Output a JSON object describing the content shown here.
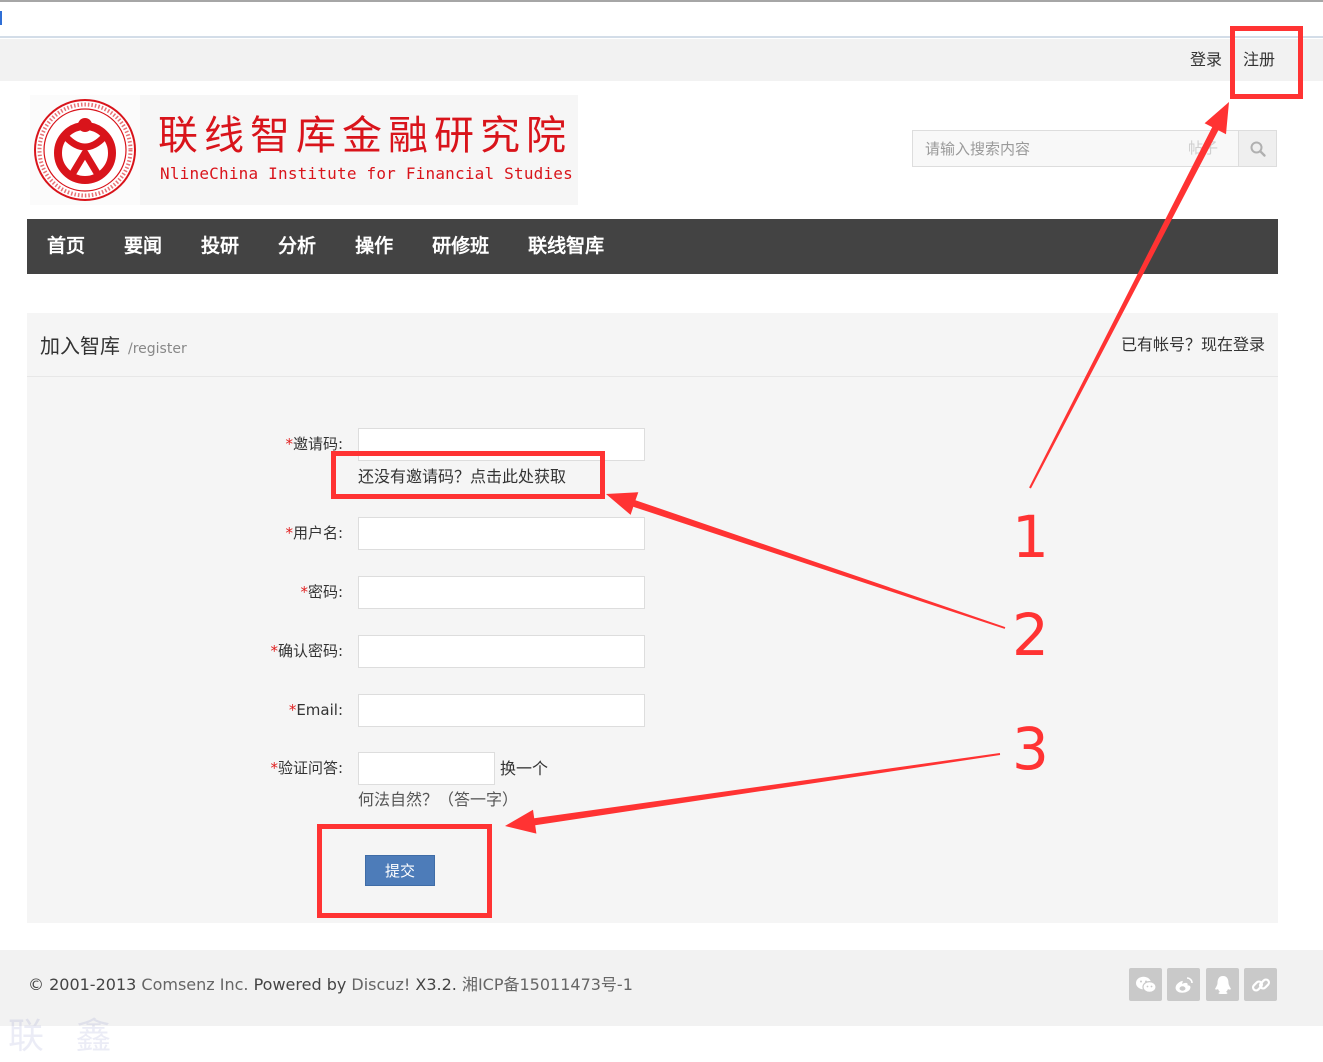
{
  "topbar": {
    "login": "登录",
    "register": "注册"
  },
  "logo": {
    "title_cn": "联线智库金融研究院",
    "title_en": "NlineChina Institute for Financial Studies",
    "brand_color": "#d9141b"
  },
  "search": {
    "placeholder": "请输入搜索内容",
    "scope": "帖子",
    "icon": "search-icon"
  },
  "nav": {
    "items": [
      "首页",
      "要闻",
      "投研",
      "分析",
      "操作",
      "研修班",
      "联线智库"
    ],
    "background": "#434343"
  },
  "panel": {
    "title": "加入智库",
    "subtitle": "/register",
    "login_prompt": "已有帐号？现在登录"
  },
  "form": {
    "required_mark": "*",
    "fields": [
      {
        "label": "邀请码:",
        "value": ""
      },
      {
        "label": "用户名:",
        "value": ""
      },
      {
        "label": "密码:",
        "value": ""
      },
      {
        "label": "确认密码:",
        "value": ""
      },
      {
        "label": "Email:",
        "value": ""
      },
      {
        "label": "验证问答:",
        "value": ""
      }
    ],
    "invite_hint": "还没有邀请码？点击此处获取",
    "captcha_refresh": "换一个",
    "captcha_question": "何法自然？（答一字）",
    "submit_label": "提交",
    "submit_color": "#4d7cb9"
  },
  "footer": {
    "copyright": "© 2001-2013",
    "company": "Comsenz Inc.",
    "powered_by": "Powered by",
    "product": "Discuz!",
    "version": "X3.2.",
    "icp": "湘ICP备15011473号-1",
    "social_icons": [
      "wechat-icon",
      "weibo-icon",
      "qq-icon",
      "link-icon"
    ]
  },
  "annotations": {
    "step_numbers": [
      "1",
      "2",
      "3"
    ],
    "color": "#ff3333"
  },
  "watermark": "联 鑫"
}
